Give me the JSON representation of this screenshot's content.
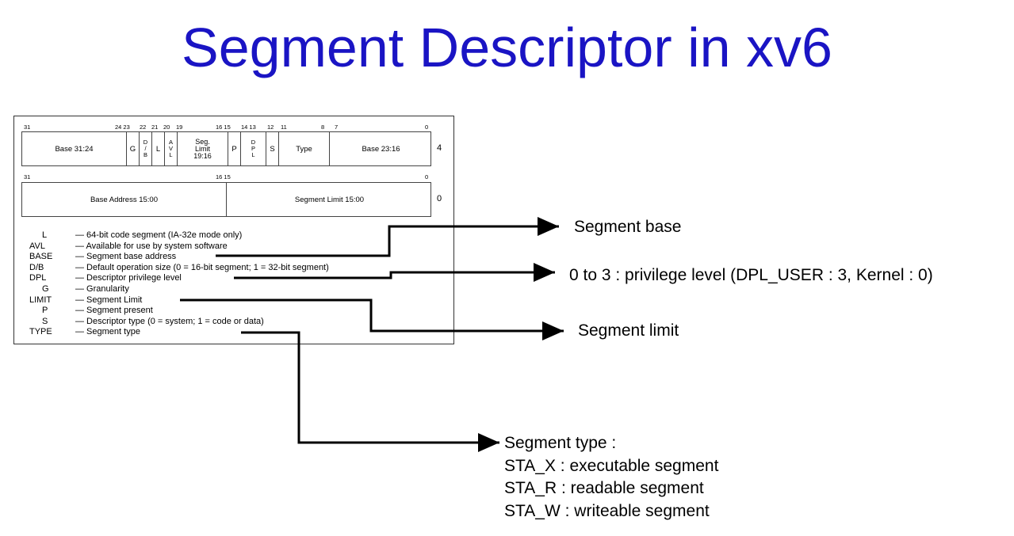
{
  "title": "Segment Descriptor in xv6",
  "descriptor": {
    "high_bits": [
      "31",
      "24 23",
      "22",
      "21",
      "20",
      "19",
      "16 15",
      "14 13",
      "12",
      "11",
      "8",
      "7",
      "0"
    ],
    "high_row_number": "4",
    "high_fields": {
      "base_31_24": "Base 31:24",
      "g": "G",
      "db": [
        "D",
        "/",
        "B"
      ],
      "l": "L",
      "avl": [
        "A",
        "V",
        "L"
      ],
      "seg_limit": [
        "Seg.",
        "Limit",
        "19:16"
      ],
      "p": "P",
      "dpl": [
        "D",
        "P",
        "L"
      ],
      "s": "S",
      "type": "Type",
      "base_23_16": "Base 23:16"
    },
    "low_bits": [
      "31",
      "16 15",
      "0"
    ],
    "low_row_number": "0",
    "low_fields": {
      "base_address": "Base Address 15:00",
      "segment_limit": "Segment Limit 15:00"
    },
    "legend": [
      {
        "key": "L",
        "desc": "— 64-bit code segment (IA-32e mode only)"
      },
      {
        "key": "AVL",
        "desc": "— Available for use by system software"
      },
      {
        "key": "BASE",
        "desc": "— Segment base address"
      },
      {
        "key": "D/B",
        "desc": "— Default operation size (0 = 16-bit segment; 1 = 32-bit segment)"
      },
      {
        "key": "DPL",
        "desc": "— Descriptor privilege level"
      },
      {
        "key": "G",
        "desc": "— Granularity"
      },
      {
        "key": "LIMIT",
        "desc": "— Segment Limit"
      },
      {
        "key": "P",
        "desc": "— Segment present"
      },
      {
        "key": "S",
        "desc": "— Descriptor type (0 = system; 1 = code or data)"
      },
      {
        "key": "TYPE",
        "desc": "— Segment type"
      }
    ]
  },
  "annotations": {
    "segment_base": "Segment base",
    "privilege": "0 to 3 : privilege level (DPL_USER : 3, Kernel : 0)",
    "segment_limit": "Segment limit",
    "segment_type": [
      "Segment type :",
      "STA_X : executable segment",
      "STA_R : readable segment",
      "STA_W : writeable segment"
    ]
  }
}
